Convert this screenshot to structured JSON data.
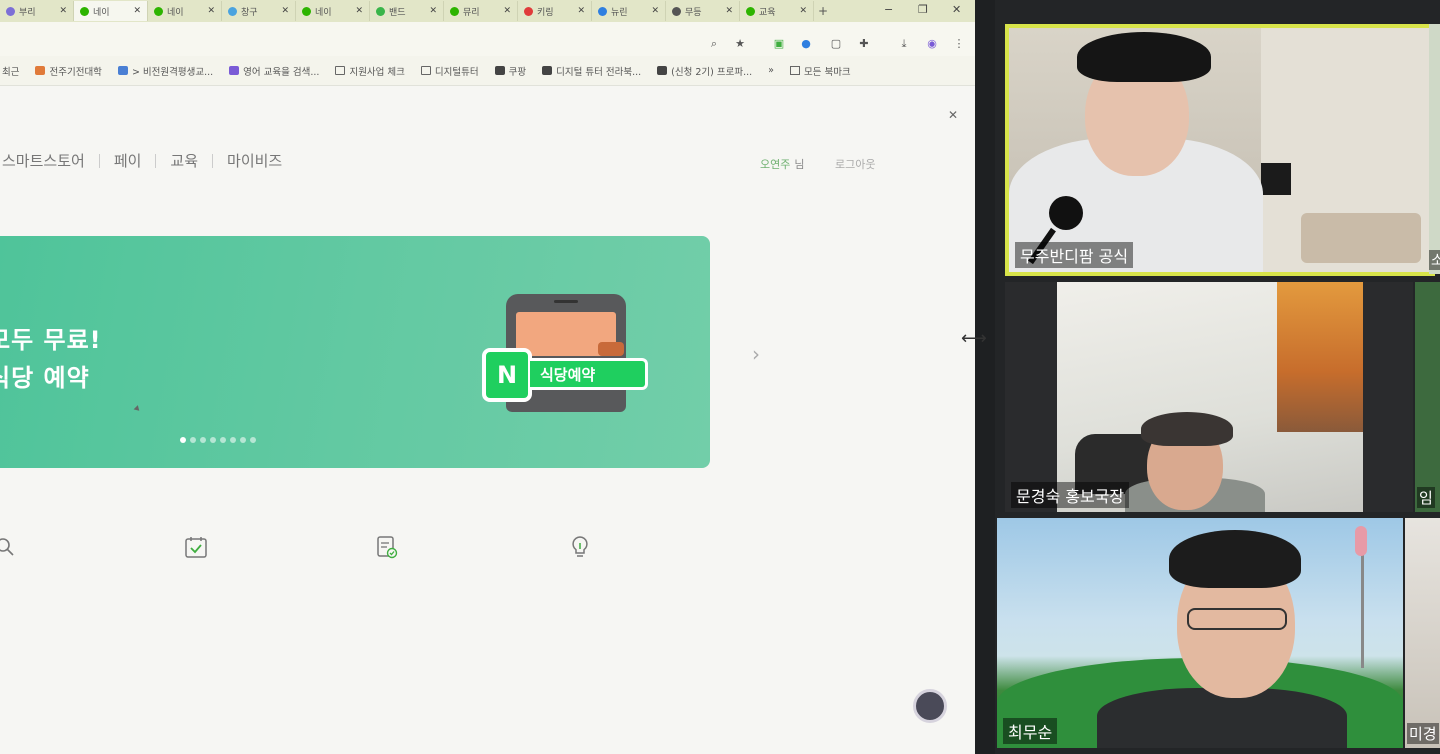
{
  "browser": {
    "tabs": [
      {
        "label": "부리",
        "fav": "#7c6fd6",
        "active": false
      },
      {
        "label": "네이",
        "fav": "#2db400",
        "active": true
      },
      {
        "label": "네이",
        "fav": "#2db400",
        "active": false
      },
      {
        "label": "창구",
        "fav": "#4aa3df",
        "active": false
      },
      {
        "label": "네이",
        "fav": "#2db400",
        "active": false
      },
      {
        "label": "밴드",
        "fav": "#39b54a",
        "active": false
      },
      {
        "label": "뮤리",
        "fav": "#2db400",
        "active": false
      },
      {
        "label": "키링",
        "fav": "#e03b3b",
        "active": false
      },
      {
        "label": "뉴린",
        "fav": "#2f7fe0",
        "active": false
      },
      {
        "label": "무등",
        "fav": "#555555",
        "active": false
      },
      {
        "label": "교육",
        "fav": "#2db400",
        "active": false
      }
    ],
    "new_tab": "+",
    "window_controls": {
      "minimize": "−",
      "restore": "❐",
      "close": "✕"
    },
    "toolbar_icons": [
      "zoom-icon",
      "star-icon",
      "extension-icon",
      "puzzle-icon",
      "download-icon",
      "profile-icon",
      "more-icon"
    ],
    "bookmarks": [
      {
        "label": "최근",
        "icon": "none"
      },
      {
        "label": "전주기전대학",
        "icon": "#e07a3a"
      },
      {
        "label": "> 비전원격평생교...",
        "icon": "#4a7fd4"
      },
      {
        "label": "영어 교육을 검색...",
        "icon": "#7a5bd6"
      },
      {
        "label": "지원사업 체크",
        "icon": "folder"
      },
      {
        "label": "디지털튜터",
        "icon": "folder"
      },
      {
        "label": "쿠팡",
        "icon": "#444444"
      },
      {
        "label": "디지털 튜터 전라북...",
        "icon": "#444444"
      },
      {
        "label": "(신청 2기) 프로파...",
        "icon": "#444444"
      }
    ],
    "bookmarks_more": "»",
    "bookmarks_all": "모든 북마크"
  },
  "page": {
    "close_ad": "✕",
    "nav": [
      "스마트스토어",
      "페이",
      "교육",
      "마이비즈"
    ],
    "user_name": "오연주",
    "user_suffix": "님",
    "logout": "로그아웃",
    "banner": {
      "line1": "모두 무료!",
      "line2": "식당 예약",
      "badge_letter": "N",
      "badge_label": "식당예약",
      "dot_count": 8,
      "active_dot": 0,
      "bg_color": "#5cc79f"
    },
    "next_arrow": "›",
    "quick_icons": [
      "search-icon",
      "calendar-check-icon",
      "document-check-icon",
      "lightbulb-icon"
    ]
  },
  "meeting": {
    "participants": [
      {
        "name": "무주반디팜 공식",
        "speaking": true
      },
      {
        "name": "문경숙 홍보국장",
        "speaking": false
      },
      {
        "name": "최무순",
        "speaking": false
      }
    ],
    "partial_names": [
      "소",
      "임",
      "미경"
    ],
    "speaker_color": "#d8e44a"
  }
}
